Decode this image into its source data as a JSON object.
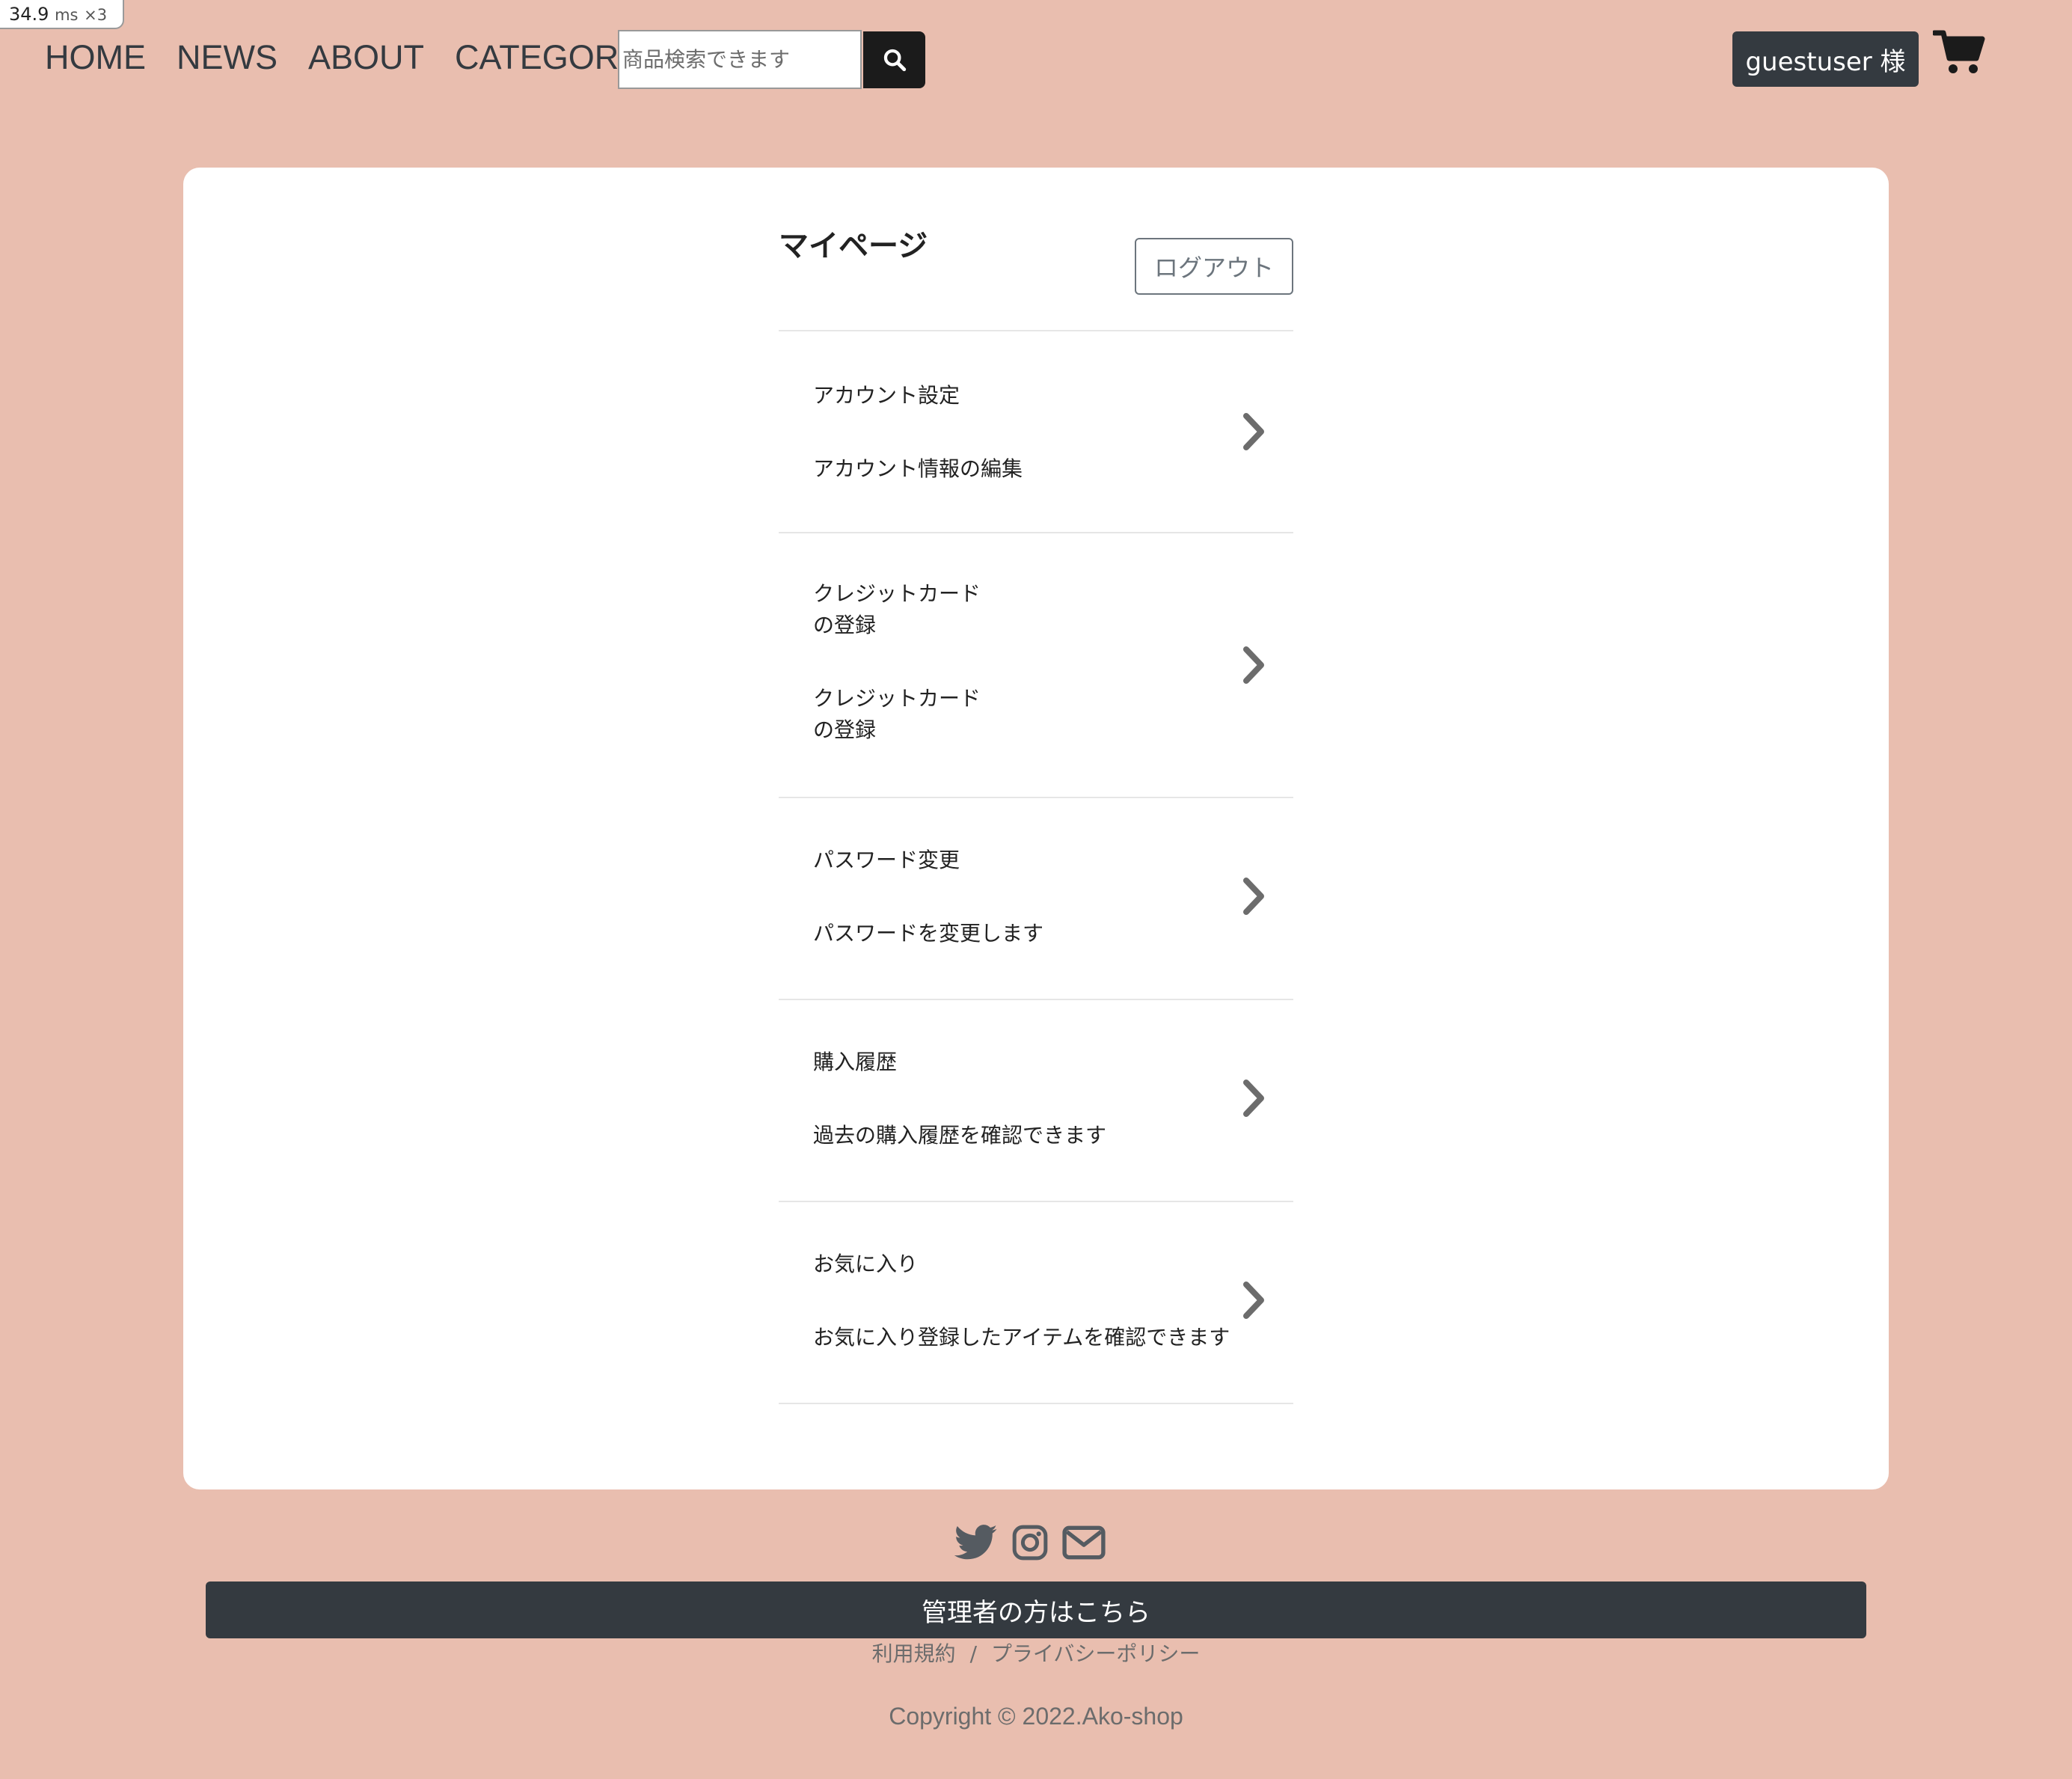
{
  "perf": {
    "value": "34.9",
    "unit": "ms",
    "mult": "×3"
  },
  "nav": {
    "links": [
      "HOME",
      "NEWS",
      "ABOUT",
      "CATEGORY"
    ],
    "search_placeholder": "商品検索できます",
    "user_label": "guestuser 様"
  },
  "mypage": {
    "title": "マイページ",
    "logout_label": "ログアウト",
    "items": [
      {
        "title": "アカウント設定",
        "desc": "アカウント情報の編集"
      },
      {
        "title": "クレジットカード\nの登録",
        "desc": "クレジットカード\nの登録"
      },
      {
        "title": "パスワード変更",
        "desc": "パスワードを変更します"
      },
      {
        "title": "購入履歴",
        "desc": "過去の購入履歴を確認できます"
      },
      {
        "title": "お気に入り",
        "desc": "お気に入り登録したアイテムを確認できます"
      }
    ]
  },
  "footer": {
    "social_icons": [
      "twitter-icon",
      "instagram-icon",
      "mail-icon"
    ],
    "admin_label": "管理者の方はこちら",
    "terms_label": "利用規約",
    "separator": "/",
    "privacy_label": "プライバシーポリシー",
    "copyright": "Copyright © 2022.Ako-shop"
  },
  "colors": {
    "background": "#e9beaf",
    "dark_button": "#343a40",
    "search_button": "#1b1b1b",
    "chevron": "#6c6c6c"
  }
}
